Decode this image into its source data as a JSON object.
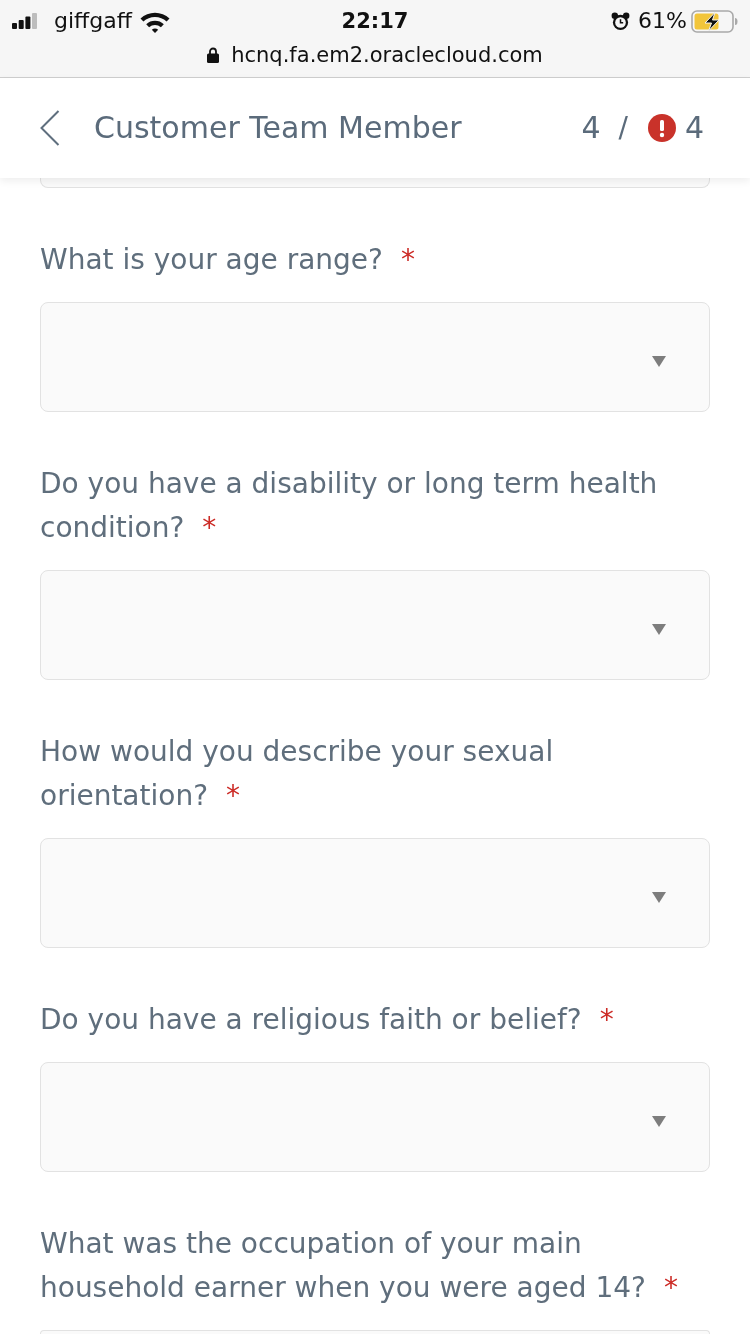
{
  "status_bar": {
    "carrier": "giffgaff",
    "time": "22:17",
    "battery_percent": "61%",
    "url": "hcnq.fa.em2.oraclecloud.com"
  },
  "header": {
    "title": "Customer Team Member",
    "current_step": "4",
    "separator": "/",
    "error_count": "4"
  },
  "questions": [
    {
      "label": "What is your age range?",
      "required_mark": "*"
    },
    {
      "label": "Do you have a disability or long term health condition?",
      "required_mark": "*"
    },
    {
      "label": "How would you describe your sexual orientation?",
      "required_mark": "*"
    },
    {
      "label": "Do you have a religious faith or belief?",
      "required_mark": "*"
    },
    {
      "label": "What was the occupation of your main household earner when you were aged 14?",
      "required_mark": "*"
    }
  ]
}
